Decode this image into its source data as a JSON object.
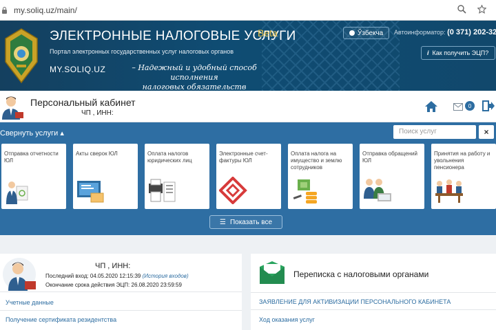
{
  "browser": {
    "url": "my.soliq.uz/main/"
  },
  "header": {
    "title": "ЭЛЕКТРОННЫЕ НАЛОГОВЫЕ УСЛУГИ",
    "beta": "Beta",
    "portal": "Портал электронных государственных услуг налоговых органов",
    "site": "MY.SOLIQ.UZ",
    "slogan_line1": "– Надежный и удобный способ исполнения",
    "slogan_line2": "налоговых обязательств",
    "language_button": "Ўзбекча",
    "autoinformer_label": "Автоинформатор:",
    "autoinformer_phone": "(0 371) 202-32-82",
    "eds_button": "Как получить ЭЦП?"
  },
  "cabinet": {
    "title": "Персональный кабинет",
    "subtitle": "ЧП , ИНН:",
    "mail_count": "0"
  },
  "services": {
    "collapse_label": "Свернуть услуги",
    "search_placeholder": "Поиск услуг",
    "close_label": "×",
    "tiles": [
      {
        "label": "Отправка отчетности ЮЛ",
        "icon": "reporting-person-icon"
      },
      {
        "label": "Акты сверок ЮЛ",
        "icon": "monitor-folder-icon"
      },
      {
        "label": "Оплата налогов юридических лиц",
        "icon": "printer-documents-icon"
      },
      {
        "label": "Электронные счет-фактуры ЮЛ",
        "icon": "e-invoice-logo-icon"
      },
      {
        "label": "Оплата налога на имущество и землю сотрудников",
        "icon": "property-coins-icon"
      },
      {
        "label": "Отправка обращений ЮЛ",
        "icon": "people-laptop-icon"
      },
      {
        "label": "Принятия на работу и увольнения пенсионера",
        "icon": "meeting-table-icon"
      }
    ],
    "show_all_label": "Показать все"
  },
  "profile_card": {
    "name": "ЧП , ИНН:",
    "last_login_label": "Последний вход: 04.05.2020 12:15:39",
    "login_history_label": "(История входов)",
    "eds_expiry": "Окончание срока действия ЭЦП: 26.08.2020 23:59:59",
    "links": [
      "Учетные данные",
      "Получение сертификата резидентства"
    ]
  },
  "correspondence_card": {
    "title": "Переписка с налоговыми органами",
    "links": [
      "ЗАЯВЛЕНИЕ ДЛЯ АКТИВИЗАЦИИ ПЕРСОНАЛЬНОГО КАБИНЕТА",
      "Ход оказания услуг"
    ]
  },
  "colors": {
    "brand_blue": "#2e6ea3",
    "banner_dark": "#0f4c73",
    "beta_gold": "#f0c64a",
    "link_blue": "#2d6da1",
    "envelope_green": "#2aa55f"
  }
}
